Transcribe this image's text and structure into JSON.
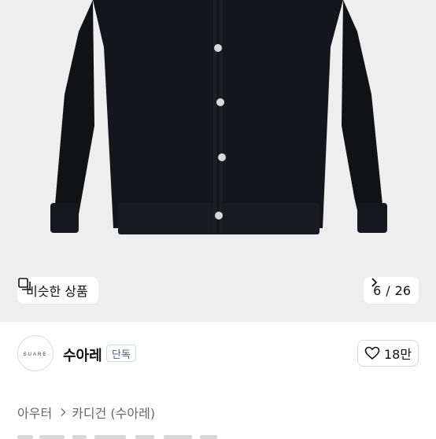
{
  "product_image": {
    "alt": "black button cardigan"
  },
  "similar_products": {
    "label": "비슷한 상품",
    "icon": "similar-items-icon"
  },
  "image_counter": {
    "current": "6",
    "separator": "/",
    "total": "26",
    "icon": "chevron-right-icon"
  },
  "shop": {
    "logo_text": "SUARE",
    "name": "수아레",
    "badge": "단독",
    "likes": "18만",
    "like_icon": "heart-icon"
  },
  "breadcrumb": {
    "category": "아우터",
    "subcategory": "카디건 (수아레)",
    "separator_icon": "chevron-right-icon"
  },
  "colors": {
    "background": "#ffffff",
    "photo_bg": "#eeeeee",
    "garment": "#121418",
    "badge_text": "#4a5a78"
  }
}
